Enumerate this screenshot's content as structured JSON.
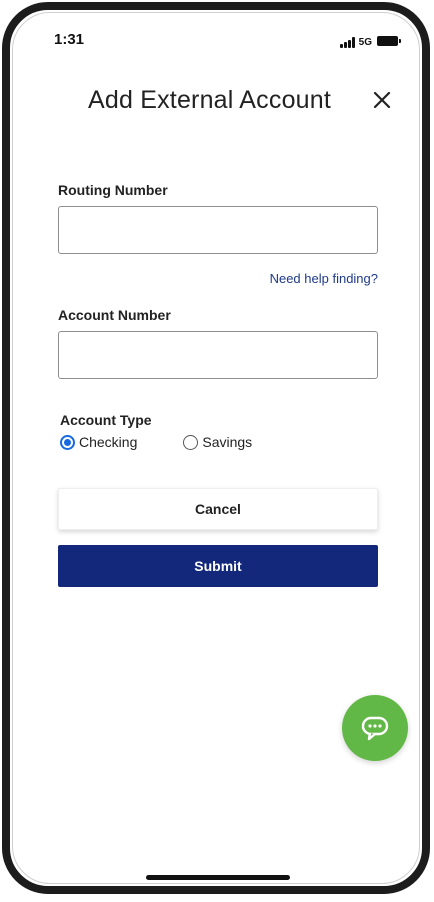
{
  "status_bar": {
    "time": "1:31",
    "network": "5G",
    "signal_icon": "signal-bars-icon",
    "battery_icon": "battery-full-icon"
  },
  "header": {
    "title": "Add External Account",
    "close_icon": "close-icon"
  },
  "form": {
    "routing": {
      "label": "Routing Number",
      "value": "",
      "placeholder": ""
    },
    "help_link": "Need help finding?",
    "account": {
      "label": "Account Number",
      "value": "",
      "placeholder": ""
    },
    "account_type": {
      "label": "Account Type",
      "options": [
        {
          "label": "Checking",
          "selected": true
        },
        {
          "label": "Savings",
          "selected": false
        }
      ]
    }
  },
  "actions": {
    "cancel_label": "Cancel",
    "submit_label": "Submit"
  },
  "chat": {
    "icon": "chat-bubble-icon"
  },
  "colors": {
    "primary_navy": "#13287a",
    "link": "#1f3a8a",
    "radio_selected": "#1769e0",
    "chat_green": "#62b846"
  }
}
